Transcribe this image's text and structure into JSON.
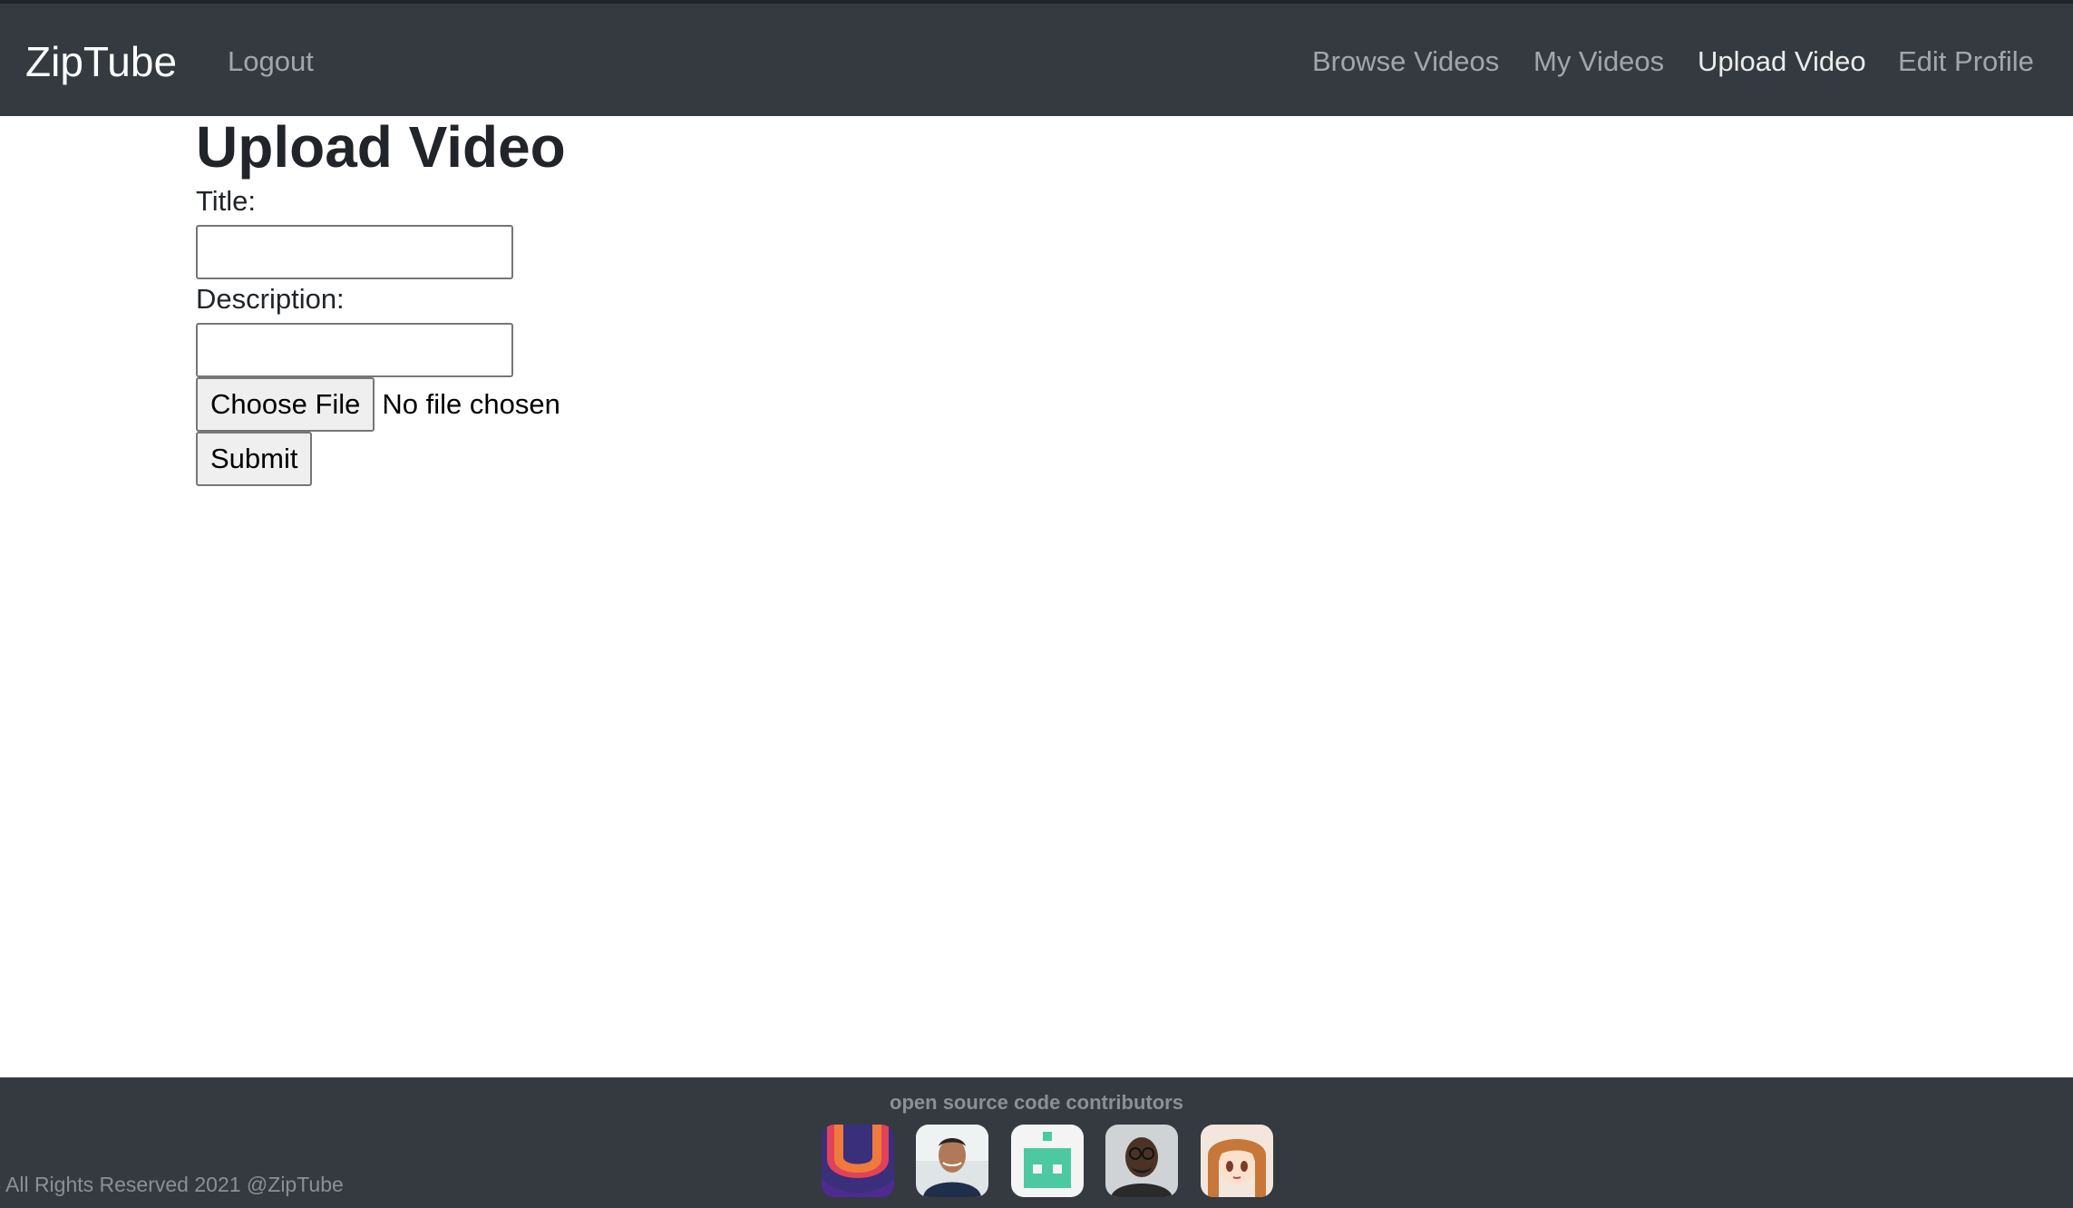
{
  "navbar": {
    "brand": "ZipTube",
    "logout": "Logout",
    "links": {
      "browse": "Browse Videos",
      "my": "My Videos",
      "upload": "Upload Video",
      "edit": "Edit Profile"
    },
    "active": "Upload Video"
  },
  "form": {
    "heading": "Upload Video",
    "title_label": "Title:",
    "title_value": "",
    "description_label": "Description:",
    "description_value": "",
    "file_button": "Choose File",
    "file_status": "No file chosen",
    "submit": "Submit"
  },
  "footer": {
    "contributors_heading": "open source code contributors",
    "avatars": [
      "contributor-1-avatar",
      "contributor-2-avatar",
      "contributor-3-avatar",
      "contributor-4-avatar",
      "contributor-5-avatar"
    ],
    "copyright": "All Rights Reserved 2021 @ZipTube"
  },
  "colors": {
    "navbar_bg": "#343a40",
    "text_dark": "#212529",
    "nav_muted": "#9a9da0",
    "footer_text": "#8a9096"
  }
}
